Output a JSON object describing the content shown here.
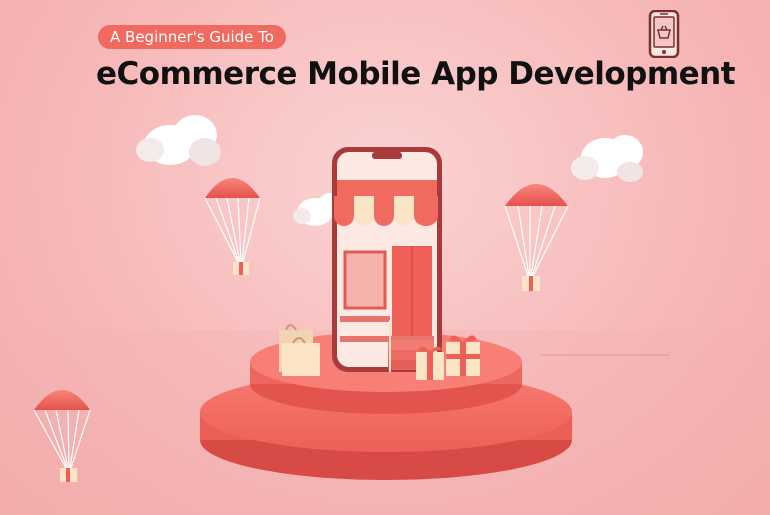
{
  "banner": {
    "subtitle": "A Beginner's Guide To",
    "title": "eCommerce Mobile App Development"
  },
  "colors": {
    "background": "#f7b9b9",
    "accent": "#f06a5f",
    "podium": "#f26b63",
    "awning_stripe": "#fbe3c6",
    "headline": "#111111"
  },
  "icons": {
    "header_icon": "mobile-shopping-basket-icon"
  }
}
